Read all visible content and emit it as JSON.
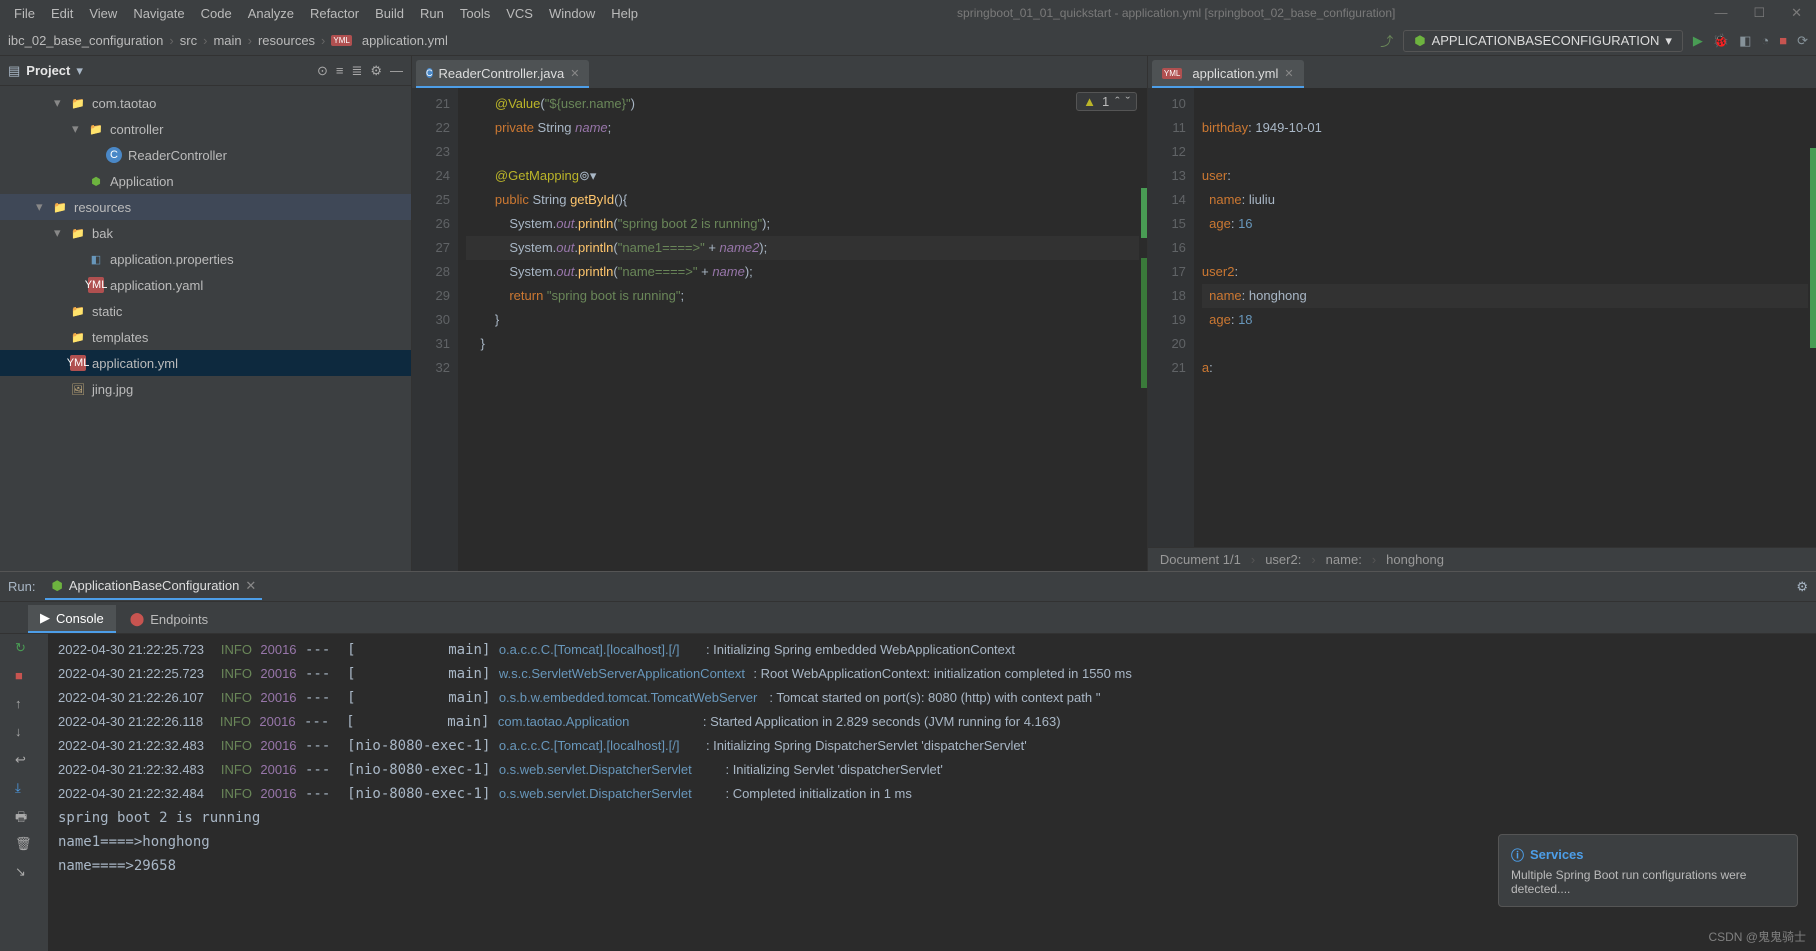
{
  "menu": [
    "File",
    "Edit",
    "View",
    "Navigate",
    "Code",
    "Analyze",
    "Refactor",
    "Build",
    "Run",
    "Tools",
    "VCS",
    "Window",
    "Help"
  ],
  "window_title": "springboot_01_01_quickstart - application.yml [srpingboot_02_base_configuration]",
  "breadcrumbs": [
    "ibc_02_base_configuration",
    "src",
    "main",
    "resources",
    "application.yml"
  ],
  "run_config": "APPLICATIONBASECONFIGURATION",
  "project": {
    "title": "Project",
    "tree": [
      {
        "indent": 3,
        "arrow": "▾",
        "icon": "folder",
        "label": "com.taotao"
      },
      {
        "indent": 4,
        "arrow": "▾",
        "icon": "folder",
        "label": "controller"
      },
      {
        "indent": 5,
        "arrow": "",
        "icon": "java",
        "label": "ReaderController"
      },
      {
        "indent": 4,
        "arrow": "",
        "icon": "spring",
        "label": "Application"
      },
      {
        "indent": 2,
        "arrow": "▾",
        "icon": "folder",
        "label": "resources",
        "sel": true
      },
      {
        "indent": 3,
        "arrow": "▾",
        "icon": "folder",
        "label": "bak"
      },
      {
        "indent": 4,
        "arrow": "",
        "icon": "prop",
        "label": "application.properties"
      },
      {
        "indent": 4,
        "arrow": "",
        "icon": "yml",
        "label": "application.yaml"
      },
      {
        "indent": 3,
        "arrow": "",
        "icon": "folder",
        "label": "static"
      },
      {
        "indent": 3,
        "arrow": "",
        "icon": "folder",
        "label": "templates"
      },
      {
        "indent": 3,
        "arrow": "",
        "icon": "yml",
        "label": "application.yml",
        "hl": true
      },
      {
        "indent": 3,
        "arrow": "",
        "icon": "file",
        "label": "jing.jpg"
      }
    ]
  },
  "editor_left": {
    "tab": "ReaderController.java",
    "warn": "1",
    "start": 21,
    "lines": [
      [
        {
          "t": "        "
        },
        {
          "c": "ann",
          "t": "@Value"
        },
        {
          "t": "("
        },
        {
          "c": "str",
          "t": "\"${user.name}\""
        },
        {
          "t": ")"
        }
      ],
      [
        {
          "t": "        "
        },
        {
          "c": "kw",
          "t": "private "
        },
        {
          "t": "String "
        },
        {
          "c": "fld",
          "t": "name"
        },
        {
          "t": ";"
        }
      ],
      [
        {
          "t": " "
        }
      ],
      [
        {
          "t": "        "
        },
        {
          "c": "ann",
          "t": "@GetMapping"
        },
        {
          "c": "gray",
          "t": "⊚▾"
        }
      ],
      [
        {
          "t": "        "
        },
        {
          "c": "kw",
          "t": "public "
        },
        {
          "t": "String "
        },
        {
          "c": "mtd",
          "t": "getById"
        },
        {
          "t": "(){"
        }
      ],
      [
        {
          "t": "            System."
        },
        {
          "c": "fld",
          "t": "out"
        },
        {
          "t": "."
        },
        {
          "c": "mtd",
          "t": "println"
        },
        {
          "t": "("
        },
        {
          "c": "str",
          "t": "\"spring boot 2 is running\""
        },
        {
          "t": ");"
        }
      ],
      [
        {
          "t": "            System."
        },
        {
          "c": "fld",
          "t": "out"
        },
        {
          "t": "."
        },
        {
          "c": "mtd",
          "t": "println"
        },
        {
          "t": "("
        },
        {
          "c": "str",
          "t": "\"name1====>\" "
        },
        {
          "t": "+ "
        },
        {
          "c": "fld",
          "t": "name2"
        },
        {
          "t": ");"
        }
      ],
      [
        {
          "t": "            System."
        },
        {
          "c": "fld",
          "t": "out"
        },
        {
          "t": "."
        },
        {
          "c": "mtd",
          "t": "println"
        },
        {
          "t": "("
        },
        {
          "c": "str",
          "t": "\"name====>\" "
        },
        {
          "t": "+ "
        },
        {
          "c": "fld",
          "t": "name"
        },
        {
          "t": ");"
        }
      ],
      [
        {
          "t": "            "
        },
        {
          "c": "kw",
          "t": "return "
        },
        {
          "c": "str",
          "t": "\"spring boot is running\""
        },
        {
          "t": ";"
        }
      ],
      [
        {
          "t": "        }"
        }
      ],
      [
        {
          "t": "    }"
        }
      ],
      [
        {
          "t": " "
        }
      ]
    ],
    "hl_line": 27
  },
  "editor_right": {
    "tab": "application.yml",
    "start": 10,
    "lines": [
      [
        {
          "t": " "
        }
      ],
      [
        {
          "c": "key",
          "t": "birthday"
        },
        {
          "t": ": "
        },
        {
          "c": "val",
          "t": "1949-10-01"
        }
      ],
      [
        {
          "t": " "
        }
      ],
      [
        {
          "c": "key",
          "t": "user"
        },
        {
          "t": ":"
        }
      ],
      [
        {
          "t": "  "
        },
        {
          "c": "key",
          "t": "name"
        },
        {
          "t": ": "
        },
        {
          "c": "val",
          "t": "liuliu"
        }
      ],
      [
        {
          "t": "  "
        },
        {
          "c": "key",
          "t": "age"
        },
        {
          "t": ": "
        },
        {
          "c": "n",
          "t": "16"
        }
      ],
      [
        {
          "t": " "
        }
      ],
      [
        {
          "c": "key",
          "t": "user2"
        },
        {
          "t": ":"
        }
      ],
      [
        {
          "t": "  "
        },
        {
          "c": "key",
          "t": "name"
        },
        {
          "t": ": "
        },
        {
          "c": "val",
          "t": "honghong"
        }
      ],
      [
        {
          "t": "  "
        },
        {
          "c": "key",
          "t": "age"
        },
        {
          "t": ": "
        },
        {
          "c": "n",
          "t": "18"
        }
      ],
      [
        {
          "t": " "
        }
      ],
      [
        {
          "c": "key",
          "t": "a"
        },
        {
          "t": ":"
        }
      ]
    ],
    "hl_line": 18,
    "status": [
      "Document 1/1",
      "user2:",
      "name:",
      "honghong"
    ]
  },
  "run_panel": {
    "label": "Run:",
    "tab": "ApplicationBaseConfiguration",
    "tabs": [
      "Console",
      "Endpoints"
    ],
    "logs": [
      {
        "ts": "2022-04-30 21:22:25.723",
        "lvl": "INFO",
        "pid": "20016",
        "thr": "---  [           main]",
        "src": "o.a.c.c.C.[Tomcat].[localhost].[/]     ",
        "msg": ": Initializing Spring embedded WebApplicationContext"
      },
      {
        "ts": "2022-04-30 21:22:25.723",
        "lvl": "INFO",
        "pid": "20016",
        "thr": "---  [           main]",
        "src": "w.s.c.ServletWebServerApplicationContext",
        "msg": ": Root WebApplicationContext: initialization completed in 1550 ms"
      },
      {
        "ts": "2022-04-30 21:22:26.107",
        "lvl": "INFO",
        "pid": "20016",
        "thr": "---  [           main]",
        "src": "o.s.b.w.embedded.tomcat.TomcatWebServer ",
        "msg": ": Tomcat started on port(s): 8080 (http) with context path ''"
      },
      {
        "ts": "2022-04-30 21:22:26.118",
        "lvl": "INFO",
        "pid": "20016",
        "thr": "---  [           main]",
        "src": "com.taotao.Application                  ",
        "msg": ": Started Application in 2.829 seconds (JVM running for 4.163)"
      },
      {
        "ts": "2022-04-30 21:22:32.483",
        "lvl": "INFO",
        "pid": "20016",
        "thr": "---  [nio-8080-exec-1]",
        "src": "o.a.c.c.C.[Tomcat].[localhost].[/]     ",
        "msg": ": Initializing Spring DispatcherServlet 'dispatcherServlet'"
      },
      {
        "ts": "2022-04-30 21:22:32.483",
        "lvl": "INFO",
        "pid": "20016",
        "thr": "---  [nio-8080-exec-1]",
        "src": "o.s.web.servlet.DispatcherServlet       ",
        "msg": ": Initializing Servlet 'dispatcherServlet'"
      },
      {
        "ts": "2022-04-30 21:22:32.484",
        "lvl": "INFO",
        "pid": "20016",
        "thr": "---  [nio-8080-exec-1]",
        "src": "o.s.web.servlet.DispatcherServlet       ",
        "msg": ": Completed initialization in 1 ms"
      }
    ],
    "out": [
      "spring boot 2 is running",
      "name1====>honghong",
      "name====>29658"
    ]
  },
  "notif": {
    "title": "Services",
    "msg": "Multiple Spring Boot run configurations were detected...."
  },
  "watermark": "CSDN @鬼鬼骑士"
}
